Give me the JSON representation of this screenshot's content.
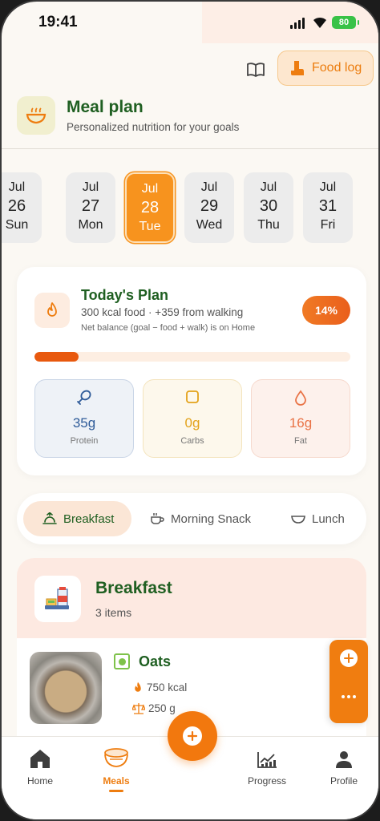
{
  "status_bar": {
    "time": "19:41",
    "battery": "80"
  },
  "top_actions": {
    "book_icon": "book-open-icon",
    "food_log_label": "Food log"
  },
  "header": {
    "title": "Meal plan",
    "subtitle": "Personalized nutrition for your goals",
    "icon": "bowl-icon"
  },
  "dates": [
    {
      "month": "Jul",
      "day": "26",
      "weekday": "Sun",
      "selected": false
    },
    {
      "month": "Jul",
      "day": "27",
      "weekday": "Mon",
      "selected": false
    },
    {
      "month": "Jul",
      "day": "28",
      "weekday": "Tue",
      "selected": true
    },
    {
      "month": "Jul",
      "day": "29",
      "weekday": "Wed",
      "selected": false
    },
    {
      "month": "Jul",
      "day": "30",
      "weekday": "Thu",
      "selected": false
    },
    {
      "month": "Jul",
      "day": "31",
      "weekday": "Fri",
      "selected": false
    }
  ],
  "plan": {
    "title": "Today's Plan",
    "subtitle": "300 kcal food · +359 from walking",
    "note": "Net balance (goal − food + walk) is on Home",
    "percent_label": "14%",
    "progress": 0.14,
    "macros": {
      "protein": {
        "value": "35g",
        "label": "Protein"
      },
      "carbs": {
        "value": "0g",
        "label": "Carbs"
      },
      "fat": {
        "value": "16g",
        "label": "Fat"
      }
    }
  },
  "meal_tabs": [
    {
      "label": "Breakfast",
      "icon": "sunrise-icon",
      "active": true
    },
    {
      "label": "Morning Snack",
      "icon": "coffee-cup-icon",
      "active": false
    },
    {
      "label": "Lunch",
      "icon": "bowl-icon",
      "active": false
    }
  ],
  "meal": {
    "title": "Breakfast",
    "count": "3 items",
    "items": [
      {
        "name": "Oats",
        "kcal": "750 kcal",
        "weight": "250 g"
      }
    ]
  },
  "bottom_nav": [
    {
      "label": "Home",
      "icon": "home-icon",
      "active": false
    },
    {
      "label": "Meals",
      "icon": "meals-bowl-icon",
      "active": true
    },
    {
      "label": "Progress",
      "icon": "chart-icon",
      "active": false
    },
    {
      "label": "Profile",
      "icon": "person-icon",
      "active": false
    }
  ],
  "colors": {
    "accent": "#f2780e",
    "title_green": "#1f5f21",
    "background": "#fbf8f3"
  }
}
